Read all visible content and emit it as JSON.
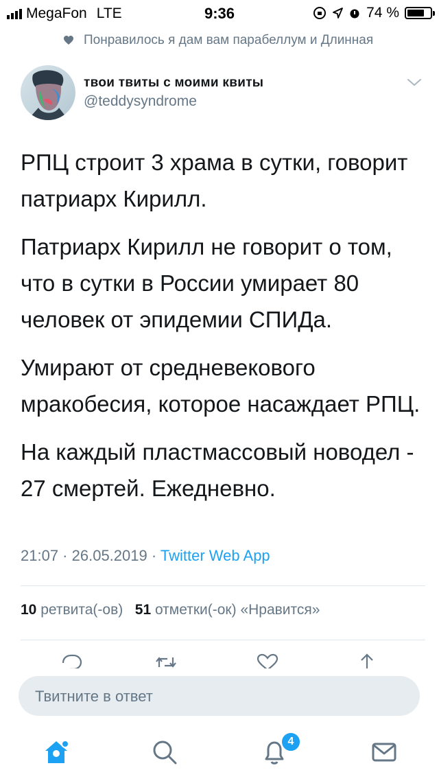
{
  "status_bar": {
    "carrier": "MegaFon",
    "network": "LTE",
    "time": "9:36",
    "battery_percent": "74 %",
    "battery_level": 0.74
  },
  "social_context": "Понравилось я дам вам парабеллум и Длинная",
  "author": {
    "name": "твои твиты с моими квиты",
    "handle": "@teddysyndrome"
  },
  "tweet": {
    "paragraphs": [
      "РПЦ строит 3 храма в сутки, говорит патриарх Кирилл.",
      "Патриарх Кирилл не говорит о том, что в сутки в России умирает 80 человек от эпидемии СПИДа.",
      "Умирают от средневекового мракобесия, которое насаждает РПЦ.",
      "На каждый пластмассовый новодел - 27 смертей. Ежедневно."
    ],
    "time": "21:07",
    "date": "26.05.2019",
    "separator": " · ",
    "source": "Twitter Web App"
  },
  "stats": {
    "retweets_count": "10",
    "retweets_label": "ретвита(-ов)",
    "likes_count": "51",
    "likes_label": "отметки(-ок) «Нравится»"
  },
  "reply": {
    "placeholder": "Твитните в ответ"
  },
  "tabbar": {
    "notifications_badge": "4"
  },
  "colors": {
    "accent": "#1da1f2",
    "secondary_text": "#657786",
    "primary_text": "#14171a",
    "input_bg": "#e6ecf0"
  }
}
